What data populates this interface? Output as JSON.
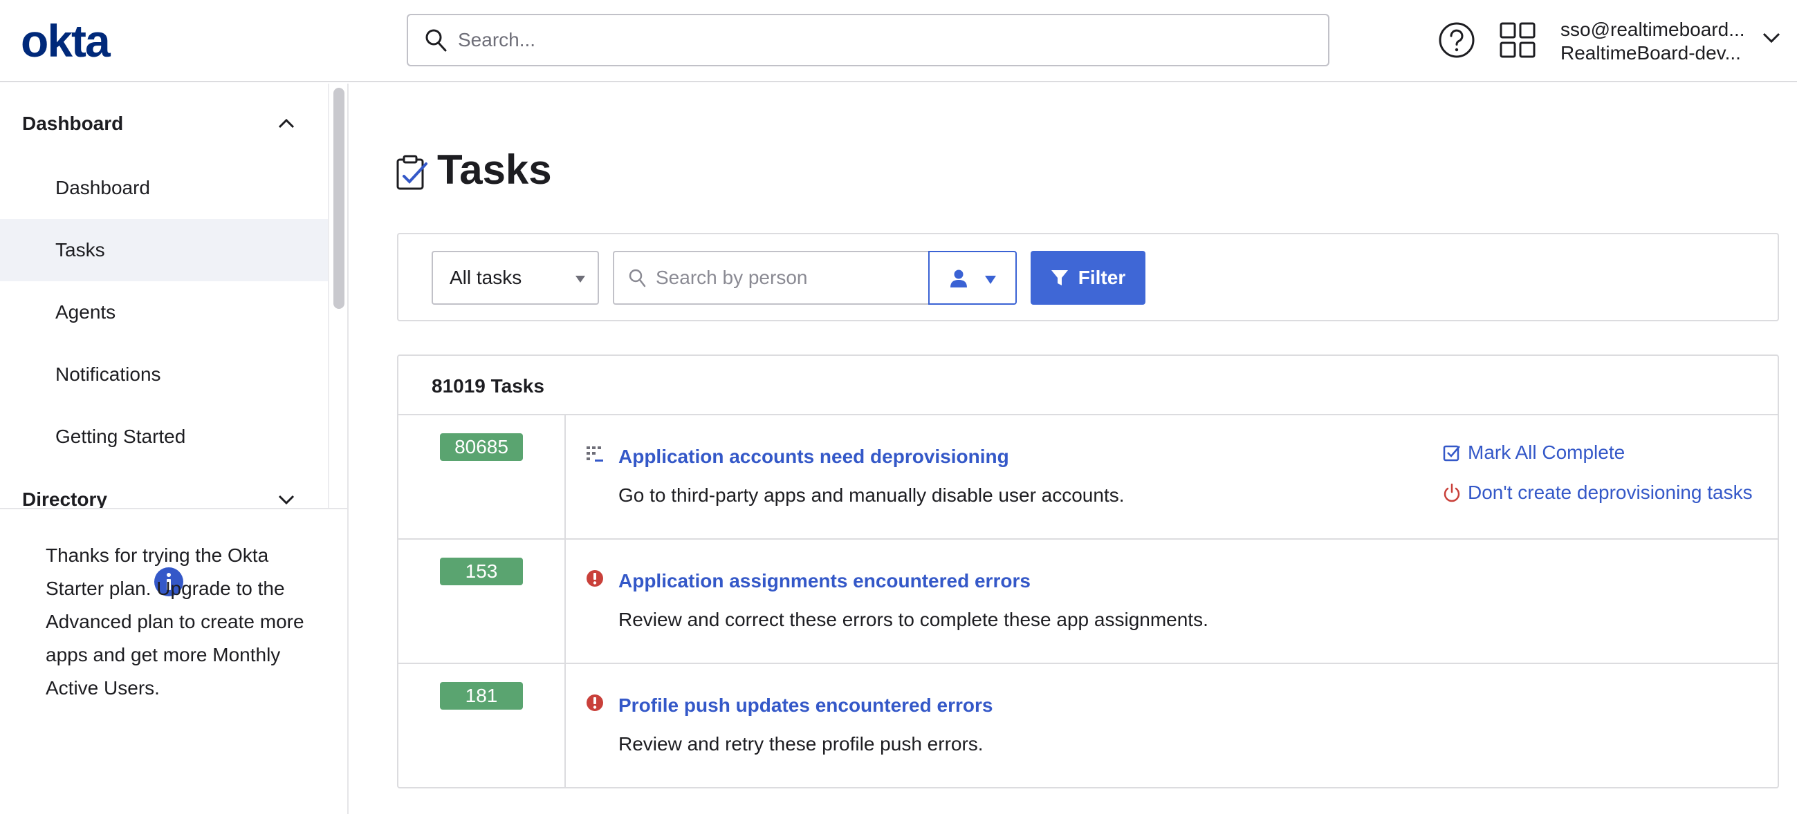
{
  "header": {
    "logo": "okta",
    "search_placeholder": "Search...",
    "user_email": "sso@realtimeboard...",
    "user_org": "RealtimeBoard-dev..."
  },
  "sidebar": {
    "section_dashboard": "Dashboard",
    "items": [
      {
        "label": "Dashboard"
      },
      {
        "label": "Tasks"
      },
      {
        "label": "Agents"
      },
      {
        "label": "Notifications"
      },
      {
        "label": "Getting Started"
      }
    ],
    "section_directory": "Directory",
    "upgrade_message": "Thanks for trying the Okta Starter plan. Upgrade to the Advanced plan to create more apps and get more Monthly Active Users."
  },
  "main": {
    "title": "Tasks",
    "filter": {
      "select_value": "All tasks",
      "person_placeholder": "Search by person",
      "filter_label": "Filter"
    },
    "tasks_count": "81019 Tasks",
    "tasks": [
      {
        "count": "80685",
        "title": "Application accounts need deprovisioning",
        "description": "Go to third-party apps and manually disable user accounts.",
        "actions": [
          "Mark All Complete",
          "Don't create deprovisioning tasks"
        ]
      },
      {
        "count": "153",
        "title": "Application assignments encountered errors",
        "description": "Review and correct these errors to complete these app assignments."
      },
      {
        "count": "181",
        "title": "Profile push updates encountered errors",
        "description": "Review and retry these profile push errors."
      }
    ]
  },
  "colors": {
    "brand": "#00297a",
    "link": "#3458c8",
    "primary_button": "#3f67d6",
    "badge": "#5aa470",
    "error": "#c9403a"
  }
}
